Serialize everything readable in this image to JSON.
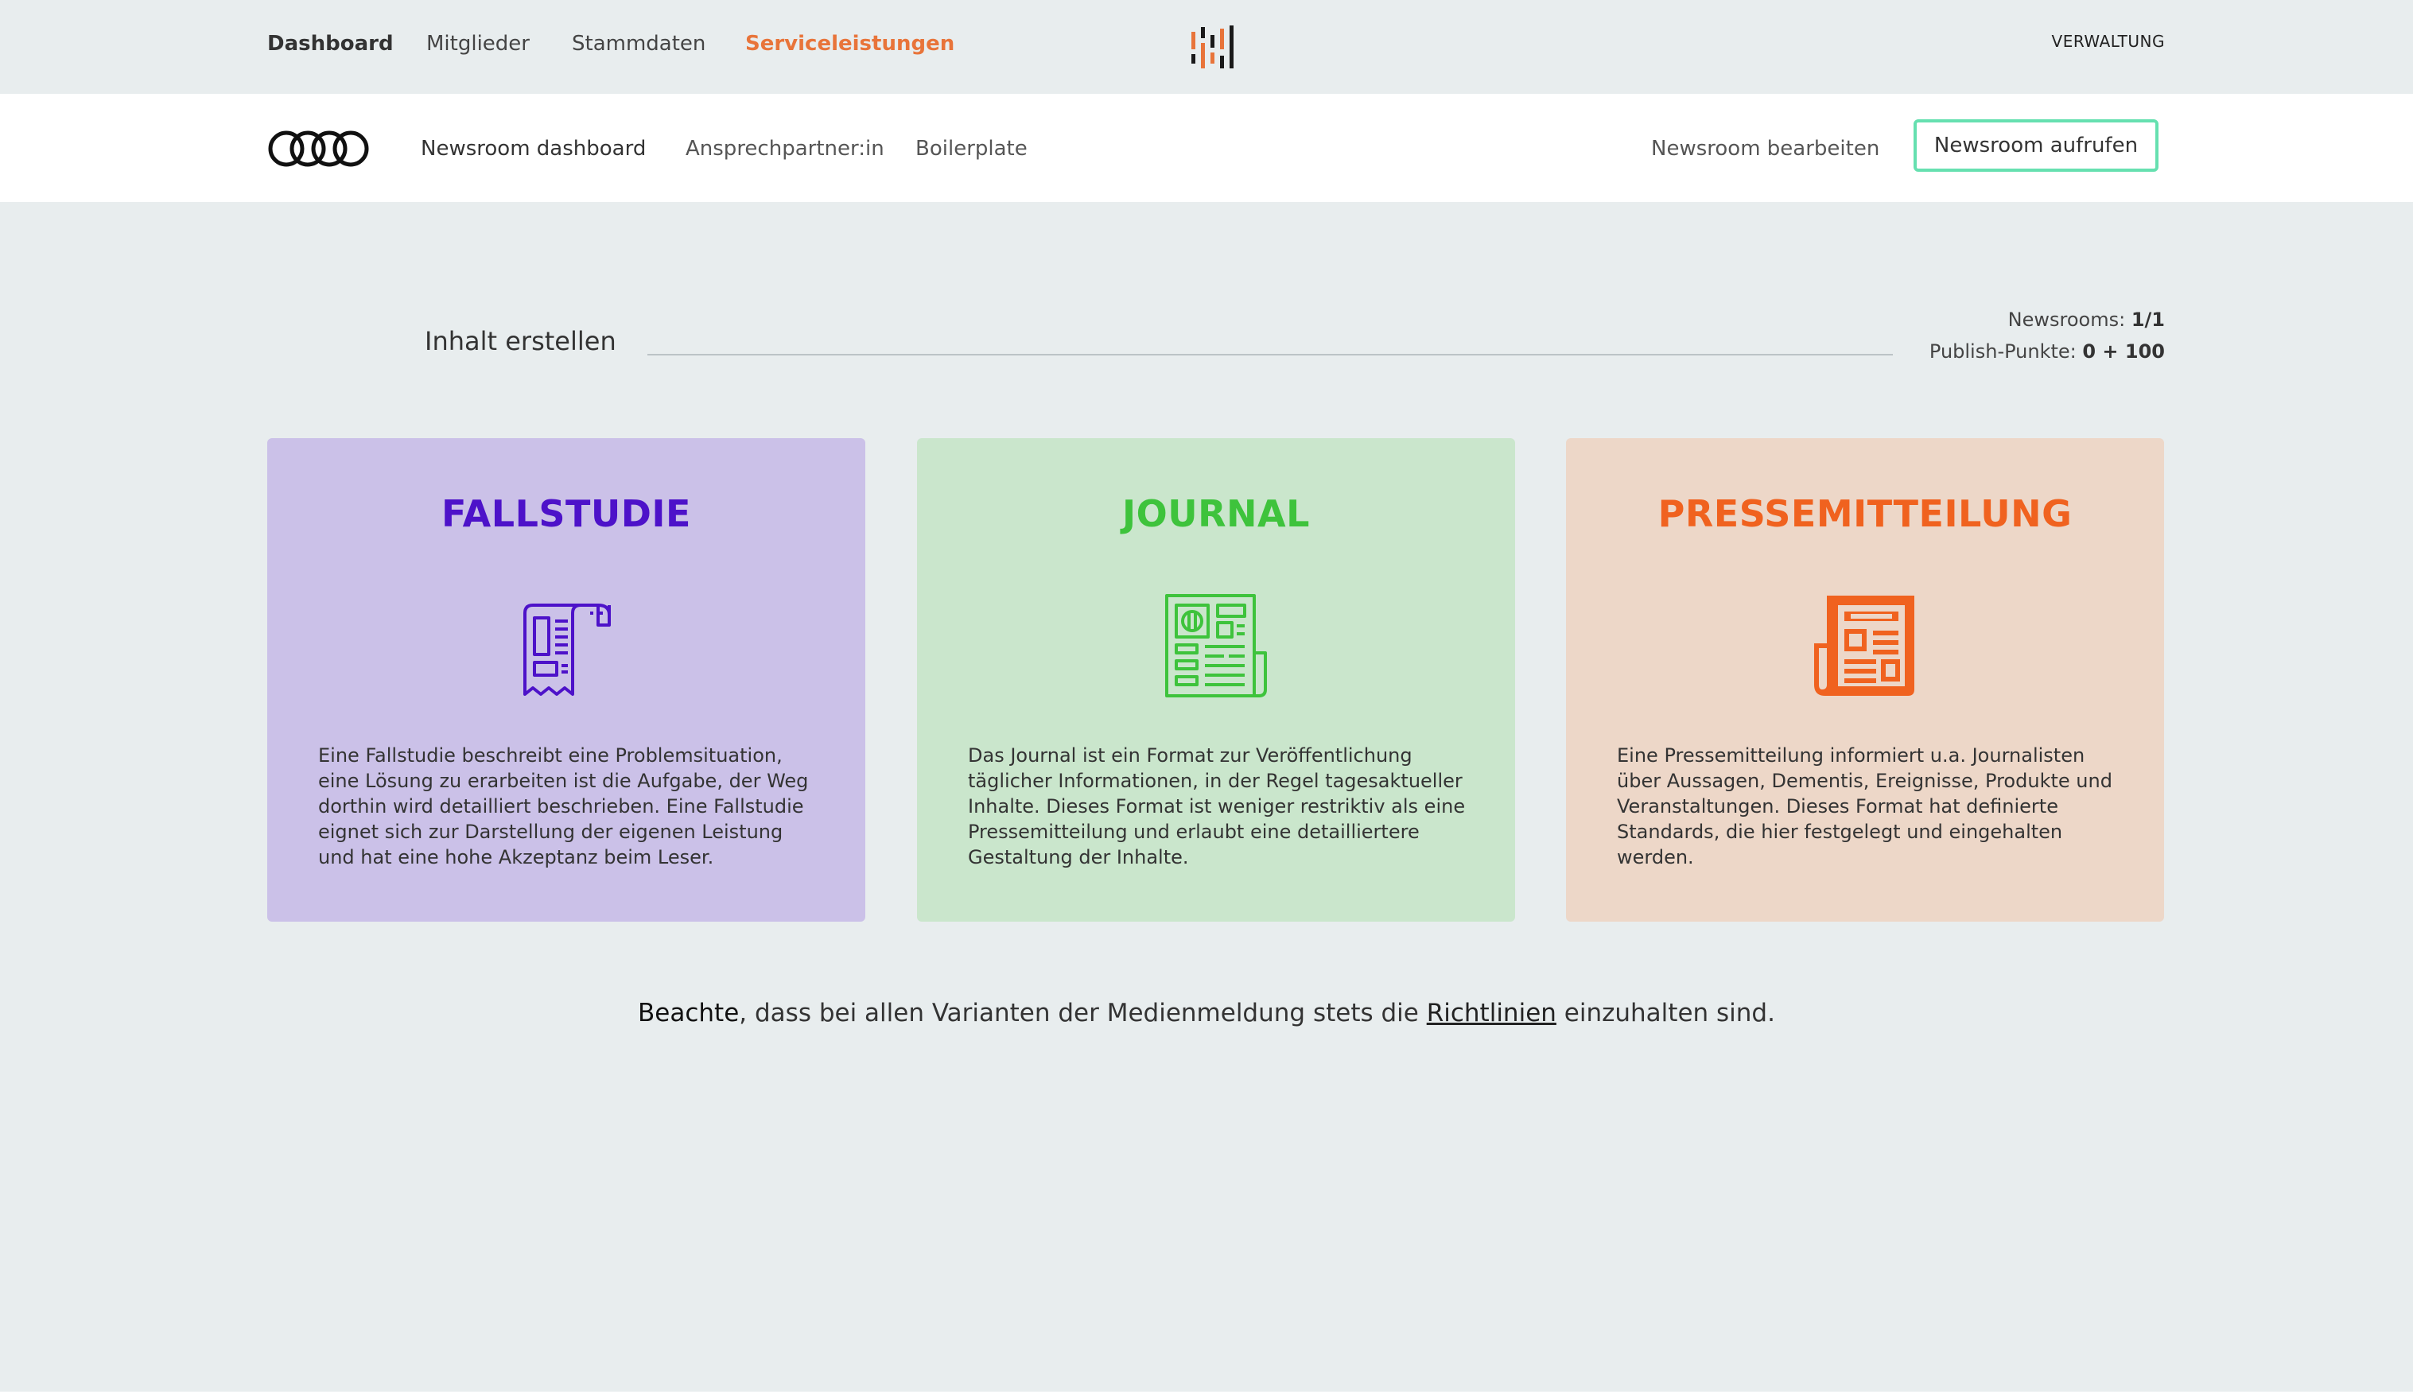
{
  "top_nav": {
    "items": [
      "Dashboard",
      "Mitglieder",
      "Stammdaten",
      "Serviceleistungen"
    ],
    "admin_link": "VERWALTUNG"
  },
  "sub_nav": {
    "items": [
      "Newsroom dashboard",
      "Ansprechpartner:in",
      "Boilerplate"
    ],
    "edit_link": "Newsroom bearbeiten",
    "open_button": "Newsroom aufrufen"
  },
  "section": {
    "title": "Inhalt erstellen",
    "newsrooms_label": "Newsrooms:",
    "newsrooms_value": "1/1",
    "points_label": "Publish-Punkte:",
    "points_value": "0 + 100"
  },
  "cards": [
    {
      "title": "FALLSTUDIE",
      "icon": "case-study-icon",
      "description": "Eine Fallstudie beschreibt eine Problemsituation, eine Lösung zu erarbeiten ist die Aufgabe, der Weg dorthin wird detailliert beschrieben. Eine Fallstudie eignet sich zur Darstellung der eigenen Leistung und hat eine hohe Akzeptanz beim Leser.",
      "color": "#4d12c9"
    },
    {
      "title": "JOURNAL",
      "icon": "journal-icon",
      "description": "Das Journal ist ein Format zur Veröffentlichung täglicher Informationen, in der Regel tagesaktueller Inhalte. Dieses Format ist weniger restriktiv als eine Pressemitteilung und erlaubt eine detailliertere Gestaltung der Inhalte.",
      "color": "#3ec33c"
    },
    {
      "title": "PRESSEMITTEILUNG",
      "icon": "press-release-icon",
      "description": "Eine Pressemitteilung informiert u.a. Journalisten über Aussagen, Dementis, Ereignisse, Produkte und Veranstaltungen. Dieses Format hat definierte Standards, die hier festgelegt und eingehalten werden.",
      "color": "#f0621f"
    }
  ],
  "note": {
    "strong": "Beachte",
    "middle": ", dass bei allen Varianten der Medienmeldung stets die ",
    "link": "Richtlinien",
    "end": " einzuhalten sind."
  },
  "colors": {
    "accent_orange": "#e8743a",
    "button_border": "#66e0b0",
    "background": "#e8edee"
  }
}
